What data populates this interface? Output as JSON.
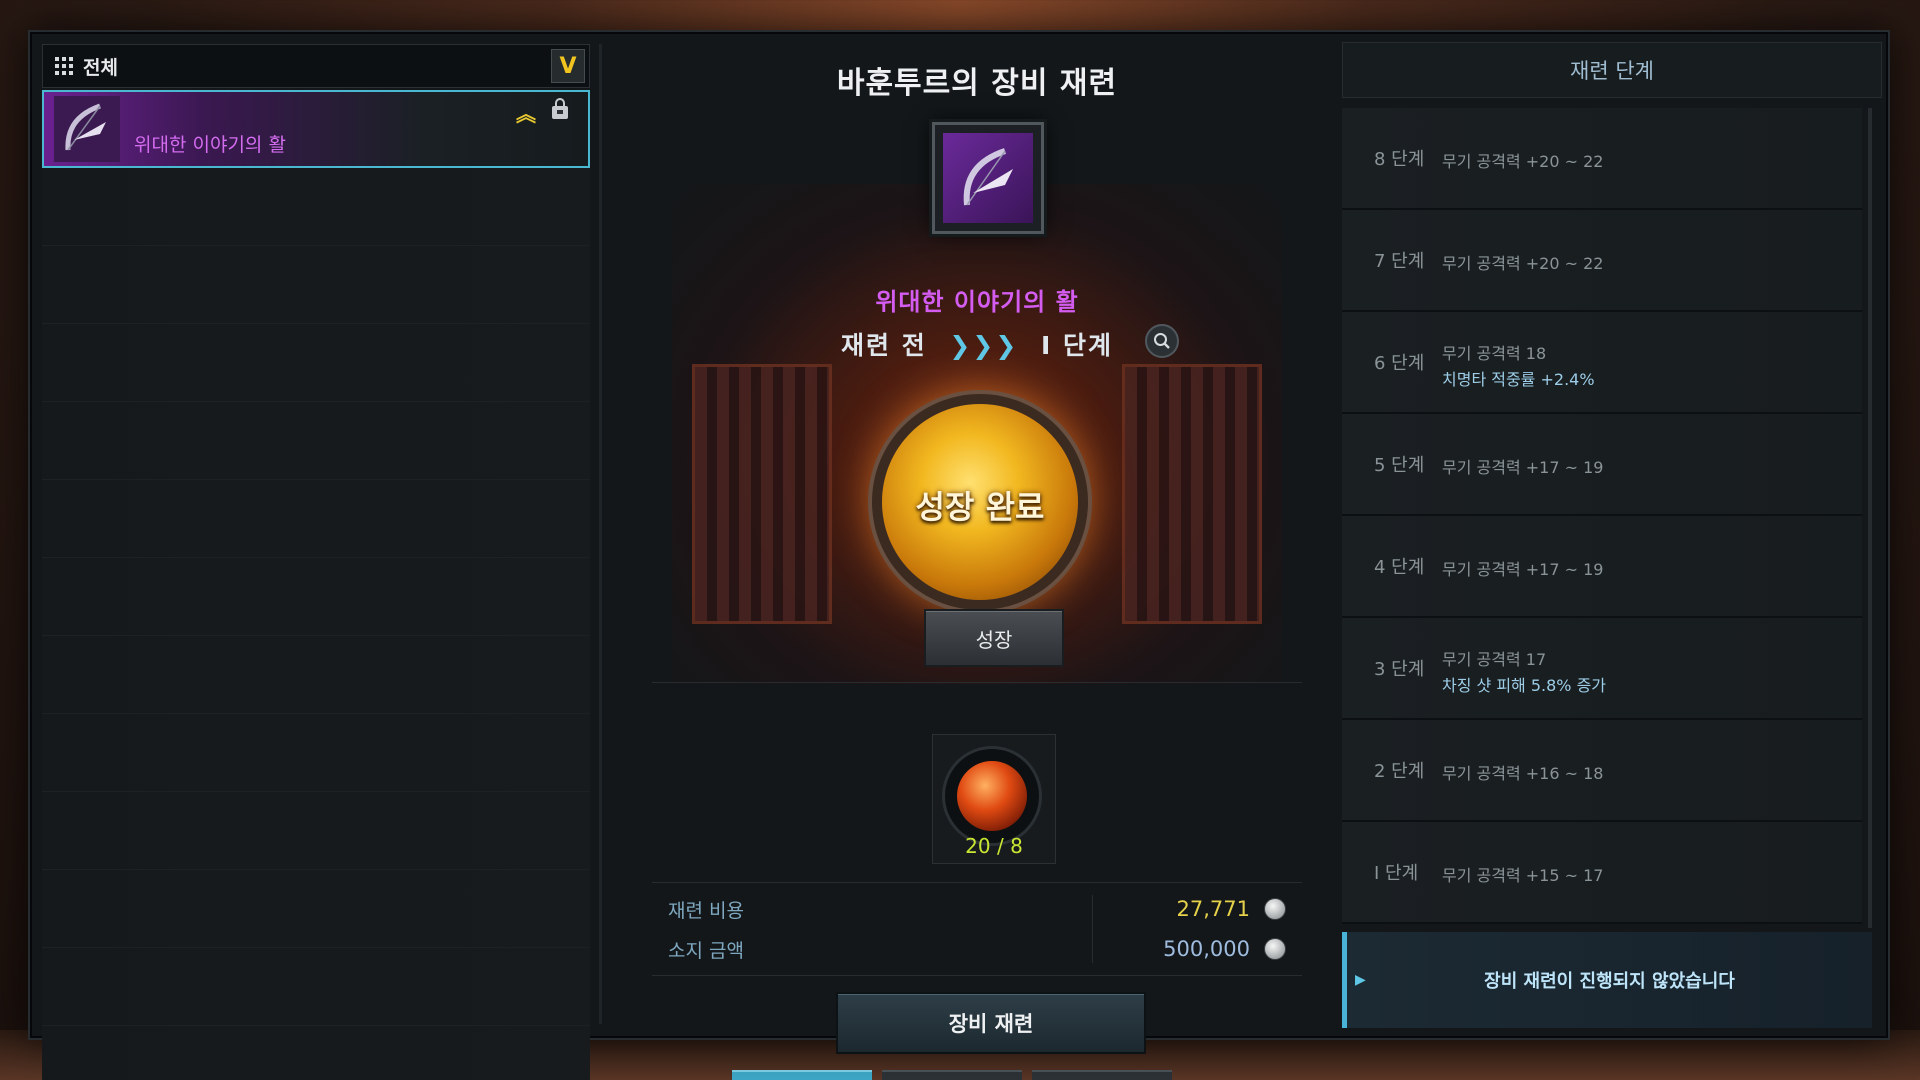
{
  "filter": {
    "label": "전체",
    "dropdown_icon": "V"
  },
  "inventory": {
    "items": [
      {
        "name": "위대한 이야기의 활",
        "badge": "︽",
        "icon": "bow-icon",
        "selected": true
      }
    ],
    "empty_rows": 12
  },
  "center": {
    "title": "바훈투르의 장비 재련",
    "item_name": "위대한 이야기의 활",
    "stage_before": "재련 전",
    "stage_arrows": "❯❯❯",
    "stage_after": "I 단계",
    "orb_text": "성장 완료",
    "grow_button": "성장",
    "material_count": "20 / 8",
    "costs": {
      "refine_cost_label": "재련 비용",
      "refine_cost_value": "27,771",
      "owned_label": "소지 금액",
      "owned_value": "500,000"
    },
    "refine_button": "장비 재련"
  },
  "stages": {
    "header": "재련 단계",
    "rows": [
      {
        "label": "8 단계",
        "stat": "무기 공격력 +20 ~ 22",
        "bonus": ""
      },
      {
        "label": "7 단계",
        "stat": "무기 공격력 +20 ~ 22",
        "bonus": ""
      },
      {
        "label": "6 단계",
        "stat": "무기 공격력 18",
        "bonus": "치명타 적중률 +2.4%"
      },
      {
        "label": "5 단계",
        "stat": "무기 공격력 +17 ~ 19",
        "bonus": ""
      },
      {
        "label": "4 단계",
        "stat": "무기 공격력 +17 ~ 19",
        "bonus": ""
      },
      {
        "label": "3 단계",
        "stat": "무기 공격력 17",
        "bonus": "차징 샷 피해 5.8% 증가"
      },
      {
        "label": "2 단계",
        "stat": "무기 공격력 +16 ~ 18",
        "bonus": ""
      },
      {
        "label": "I 단계",
        "stat": "무기 공격력 +15 ~ 17",
        "bonus": ""
      }
    ],
    "status": "장비 재련이 진행되지 않았습니다"
  },
  "colors": {
    "rare_purple": "#d45cf0",
    "accent_cyan": "#4ab4d8",
    "gold": "#e6d24a",
    "material_green": "#c8e632"
  }
}
